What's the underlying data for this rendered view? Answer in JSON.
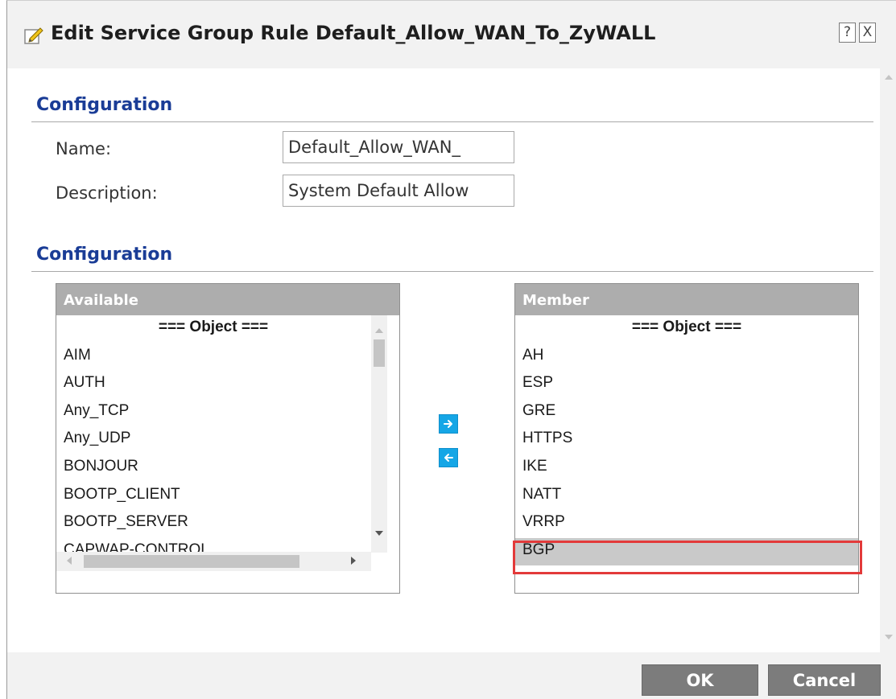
{
  "dialog": {
    "title": "Edit Service Group Rule Default_Allow_WAN_To_ZyWALL",
    "help_label": "?",
    "close_label": "X"
  },
  "general": {
    "section_title": "Configuration",
    "name_label": "Name:",
    "name_value": "Default_Allow_WAN_",
    "description_label": "Description:",
    "description_value": "System Default Allow"
  },
  "members": {
    "section_title": "Configuration",
    "available": {
      "header": "Available",
      "items": [
        "=== Object ===",
        "AIM",
        "AUTH",
        "Any_TCP",
        "Any_UDP",
        "BONJOUR",
        "BOOTP_CLIENT",
        "BOOTP_SERVER",
        "CAPWAP-CONTROL"
      ]
    },
    "member": {
      "header": "Member",
      "items": [
        "=== Object ===",
        "AH",
        "ESP",
        "GRE",
        "HTTPS",
        "IKE",
        "NATT",
        "VRRP",
        "BGP"
      ],
      "selected_item": "BGP"
    }
  },
  "footer": {
    "ok_label": "OK",
    "cancel_label": "Cancel"
  },
  "icons": {
    "title_icon": "edit-icon",
    "move_right": "arrow-right-icon",
    "move_left": "arrow-left-icon"
  },
  "colors": {
    "section_title": "#1a3c96",
    "move_button": "#15a6e6",
    "highlight": "#e33a3a",
    "footer_button": "#7c7c7c",
    "list_header": "#adadad"
  }
}
